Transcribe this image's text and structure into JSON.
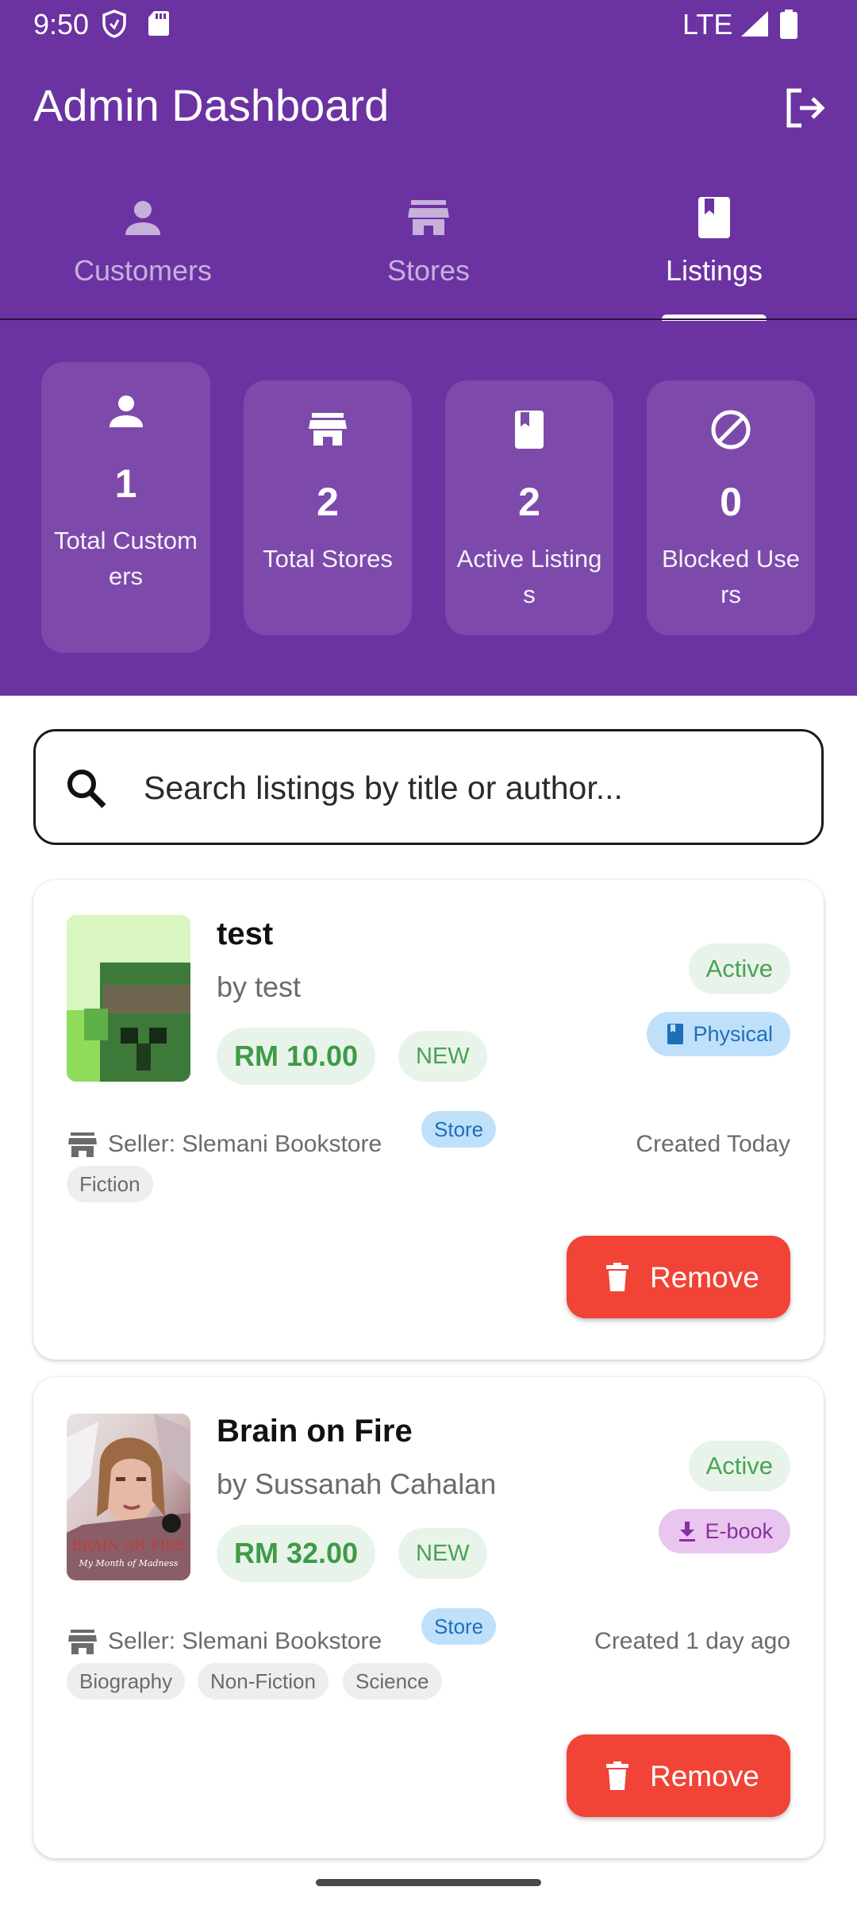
{
  "status_bar": {
    "time": "9:50",
    "network": "LTE"
  },
  "app_bar": {
    "title": "Admin Dashboard",
    "logout_icon": "logout-icon"
  },
  "tabs": [
    {
      "label": "Customers",
      "icon": "person-icon",
      "active": false
    },
    {
      "label": "Stores",
      "icon": "store-icon",
      "active": false
    },
    {
      "label": "Listings",
      "icon": "book-icon",
      "active": true
    }
  ],
  "stats": [
    {
      "value": "1",
      "label": "Total Customers",
      "icon": "person-icon"
    },
    {
      "value": "2",
      "label": "Total Stores",
      "icon": "store-icon"
    },
    {
      "value": "2",
      "label": "Active Listings",
      "icon": "book-icon"
    },
    {
      "value": "0",
      "label": "Blocked Users",
      "icon": "block-icon"
    }
  ],
  "search": {
    "placeholder": "Search listings by title or author..."
  },
  "listings": [
    {
      "title": "test",
      "author": "by test",
      "price": "RM 10.00",
      "condition": "NEW",
      "status": "Active",
      "type": "Physical",
      "seller": "Seller: Slemani Bookstore",
      "seller_badge": "Store",
      "created": "Created Today",
      "genres": [
        "Fiction"
      ],
      "remove_label": "Remove"
    },
    {
      "title": "Brain on Fire",
      "author": "by Sussanah Cahalan",
      "price": "RM 32.00",
      "condition": "NEW",
      "status": "Active",
      "type": "E-book",
      "seller": "Seller: Slemani Bookstore",
      "seller_badge": "Store",
      "created": "Created 1 day ago",
      "genres": [
        "Biography",
        "Non-Fiction",
        "Science"
      ],
      "remove_label": "Remove",
      "cover_text": [
        "BRAIN ON FIRE",
        "My Month of Madness"
      ]
    }
  ],
  "colors": {
    "primary": "#6b32a1",
    "remove": "#f14336",
    "price": "#3f9a48"
  }
}
